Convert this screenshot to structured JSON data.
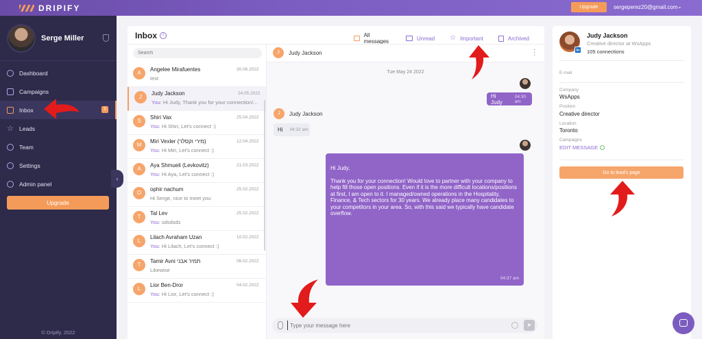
{
  "topbar": {
    "logo_text": "DRIPIFY",
    "upgrade_label": "Upgrade",
    "user_email": "sergeperez20@gmail.com"
  },
  "sidebar": {
    "profile_name": "Serge Miller",
    "items": [
      {
        "label": "Dashboard",
        "icon": "dashboard-icon"
      },
      {
        "label": "Campaigns",
        "icon": "flag-icon"
      },
      {
        "label": "Inbox",
        "icon": "inbox-icon",
        "badge": "5",
        "active": true
      },
      {
        "label": "Leads",
        "icon": "star-icon"
      },
      {
        "label": "Team",
        "icon": "team-icon"
      },
      {
        "label": "Settings",
        "icon": "gear-icon"
      },
      {
        "label": "Admin panel",
        "icon": "admin-icon"
      }
    ],
    "upgrade_label": "Upgrade",
    "copyright": "© Dripify, 2022"
  },
  "inbox": {
    "title": "Inbox",
    "filters": [
      {
        "label": "All messages"
      },
      {
        "label": "Unread"
      },
      {
        "label": "Important"
      },
      {
        "label": "Archived"
      }
    ],
    "search_placeholder": "Search",
    "conversations": [
      {
        "initial": "A",
        "name": "Angelee Mirafuentes",
        "date": "30.06.2022",
        "you": "",
        "preview": "test"
      },
      {
        "initial": "J",
        "name": "Judy Jackson",
        "date": "24.05.2022",
        "you": "You:",
        "preview": " Hi Judy, Thank you for your connection!..."
      },
      {
        "initial": "S",
        "name": "Shiri Vax",
        "date": "25.04.2022",
        "you": "You:",
        "preview": " Hi Shiri, Let's connect :)"
      },
      {
        "initial": "M",
        "name": "Miri Vexler (מירי וקסלר)",
        "date": "12.04.2022",
        "you": "You:",
        "preview": " Hi Miri, Let's connect :)"
      },
      {
        "initial": "A",
        "name": "Aya Shmueli (Levkovitz)",
        "date": "21.03.2022",
        "you": "You:",
        "preview": " Hi Aya, Let's connect :)"
      },
      {
        "initial": "O",
        "name": "ophir nachum",
        "date": "25.02.2022",
        "you": "",
        "preview": "Hi Serge, nice to meet you"
      },
      {
        "initial": "T",
        "name": "Tal Lev",
        "date": "25.02.2022",
        "you": "You:",
        "preview": " sdsdsds"
      },
      {
        "initial": "L",
        "name": "Lilach Avraham Uzan",
        "date": "10.02.2022",
        "you": "You:",
        "preview": " Hi Lilach, Let's connect :)"
      },
      {
        "initial": "T",
        "name": "Tamir Avni תמיר אבני",
        "date": "06.02.2022",
        "you": "",
        "preview": "Likewise"
      },
      {
        "initial": "L",
        "name": "Lior Ben-Dror",
        "date": "04.02.2022",
        "you": "You:",
        "preview": " Hi Lior, Let's connect :)"
      }
    ]
  },
  "chat": {
    "contact_initial": "J",
    "contact_name": "Judy Jackson",
    "date_divider": "Tue May 24 2022",
    "msg1_text": "Hi Judy",
    "msg1_time": "04:30 am",
    "them_initial": "J",
    "them_name": "Judy Jackson",
    "msg2_text": "Hi",
    "msg2_time": "04:32 am",
    "msg3_text": "Hi Judy,\n\nThank you for your connection! Would love to partner with your company to help fill those open positions. Even if it is the more difficult locations/positions at first, I am open to it. I managed/owned operations in the Hospitality, Finance, & Tech sectors for 30 years. We already place many candidates to your competitors in your area. So, with this said we typically have candidate overflow.",
    "msg3_time": "04:37 am",
    "input_placeholder": "Type your message here"
  },
  "lead": {
    "name": "Judy Jackson",
    "title": "Creative director at WsApps",
    "connections": "105 connections",
    "email_label": "E-mail",
    "company_label": "Company",
    "company": "WsApps",
    "position_label": "Position",
    "position": "Creative director",
    "location_label": "Location",
    "location": "Toronto",
    "campaigns_label": "Campaigns",
    "campaign": "EDIT MESSAGE",
    "button_label": "Go to lead's page"
  },
  "colors": {
    "accent_orange": "#f49b5a",
    "brand_purple": "#8a6bd0",
    "sidebar_bg": "#2d2a4a",
    "annotation_red": "#e21b1b"
  }
}
